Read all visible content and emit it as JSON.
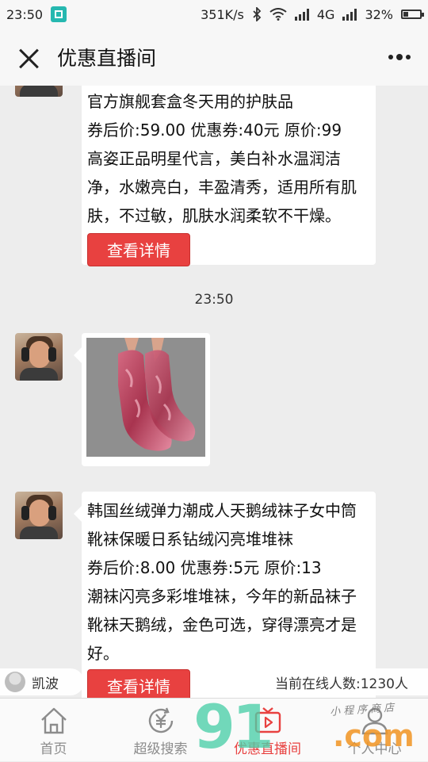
{
  "status_bar": {
    "time": "23:50",
    "net_speed": "351K/s",
    "network": "4G",
    "battery": "32%",
    "battery_level": 0.32
  },
  "header": {
    "title": "优惠直播间"
  },
  "messages": [
    {
      "type": "product",
      "lines": [
        "官方旗舰套盒冬天用的护肤品",
        "券后价:59.00 优惠券:40元 原价:99",
        "高姿正品明星代言，美白补水温润洁",
        "净，水嫩亮白，丰盈清秀，适用所有肌",
        "肤，不过敏，肌肤水润柔软不干燥。"
      ],
      "button": "查看详情"
    },
    {
      "type": "timestamp",
      "text": "23:50"
    },
    {
      "type": "image",
      "alt": "sock-photo"
    },
    {
      "type": "product",
      "lines": [
        "韩国丝绒弹力潮成人天鹅绒袜子女中筒",
        "靴袜保暖日系钻绒闪亮堆堆袜",
        "券后价:8.00 优惠券:5元 原价:13",
        "潮袜闪亮多彩堆堆袜，今年的新品袜子",
        "靴袜天鹅绒，金色可选，穿得漂亮才是",
        "好。"
      ],
      "button": "查看详情"
    }
  ],
  "online": {
    "user_name": "凯波",
    "count_text": "当前在线人数:1230人"
  },
  "tabs": [
    {
      "label": "首页",
      "icon": "home-icon"
    },
    {
      "label": "超级搜索",
      "icon": "yen-search-icon"
    },
    {
      "label": "优惠直播间",
      "icon": "live-tv-icon",
      "active": true
    },
    {
      "label": "个人中心",
      "icon": "person-icon"
    }
  ],
  "watermark": {
    "big": "91",
    "com": ".com",
    "small": "小程序商店"
  },
  "colors": {
    "accent": "#e84140",
    "background": "#ededed",
    "bubble": "#ffffff"
  }
}
